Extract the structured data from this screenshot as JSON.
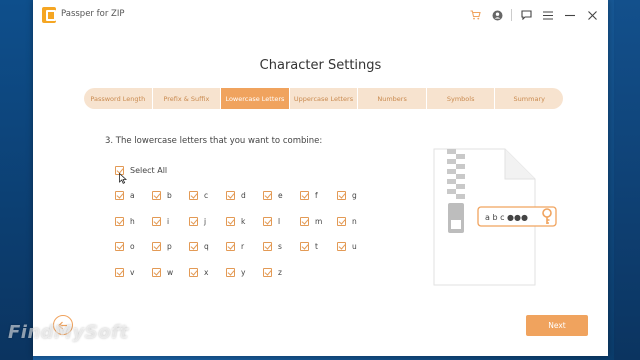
{
  "app": {
    "title": "Passper for ZIP"
  },
  "page": {
    "title": "Character Settings"
  },
  "steps": [
    {
      "label": "Password Length",
      "active": false
    },
    {
      "label": "Prefix & Suffix",
      "active": false
    },
    {
      "label": "Lowercase Letters",
      "active": true
    },
    {
      "label": "Uppercase Letters",
      "active": false
    },
    {
      "label": "Numbers",
      "active": false
    },
    {
      "label": "Symbols",
      "active": false
    },
    {
      "label": "Summary",
      "active": false
    }
  ],
  "question": "3. The lowercase letters that you want to combine:",
  "select_all": {
    "label": "Select All",
    "checked": true
  },
  "letters": [
    "a",
    "b",
    "c",
    "d",
    "e",
    "f",
    "g",
    "h",
    "i",
    "j",
    "k",
    "l",
    "m",
    "n",
    "o",
    "p",
    "q",
    "r",
    "s",
    "t",
    "u",
    "v",
    "w",
    "x",
    "y",
    "z"
  ],
  "illustration": {
    "password_text": "a b c ●●●"
  },
  "footer": {
    "next_label": "Next"
  },
  "watermark": "FindMySoft",
  "colors": {
    "accent": "#f0a35e",
    "accent_light": "#f7e3cf",
    "text": "#444444"
  },
  "icons": [
    "cart-icon",
    "account-icon",
    "feedback-icon",
    "menu-icon",
    "minimize-icon",
    "close-icon",
    "back-arrow-icon",
    "key-icon",
    "zip-file-icon"
  ]
}
